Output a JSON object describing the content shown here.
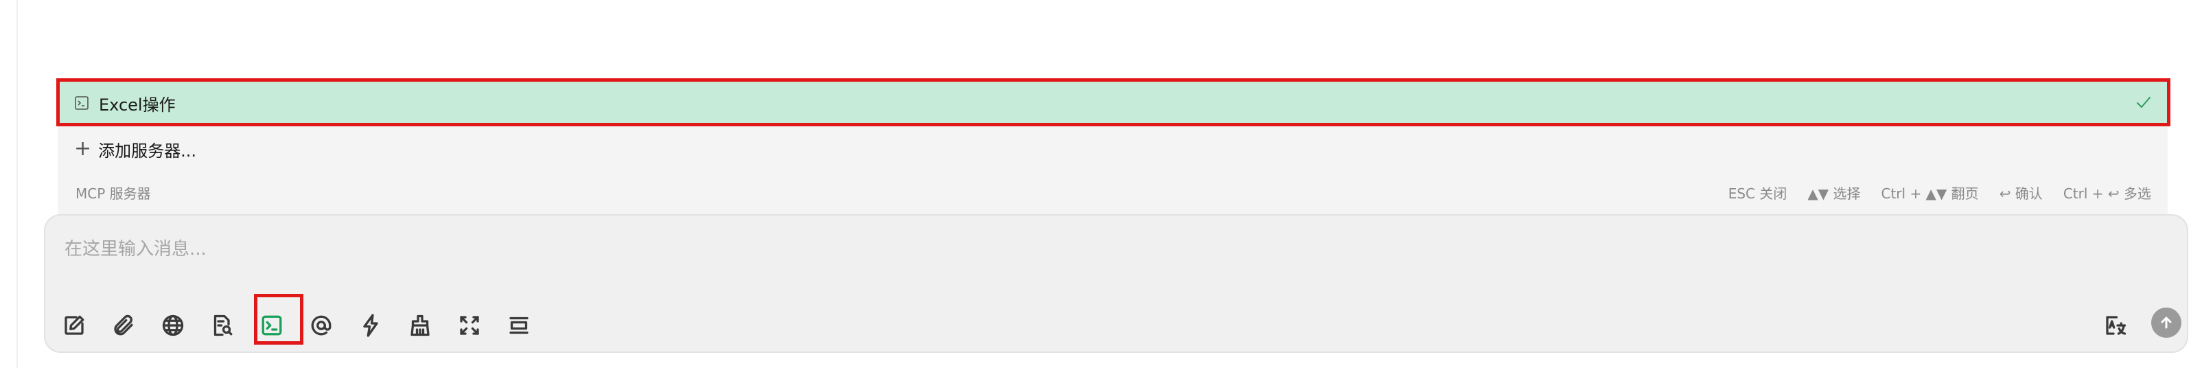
{
  "mcp_panel": {
    "servers": [
      {
        "label": "Excel操作",
        "selected": true,
        "icon": "terminal-icon"
      }
    ],
    "add_server_label": "添加服务器...",
    "footer_title": "MCP 服务器",
    "hints": [
      "ESC 关闭",
      "▲▼ 选择",
      "Ctrl + ▲▼ 翻页",
      "↩ 确认",
      "Ctrl + ↩ 多选"
    ]
  },
  "composer": {
    "placeholder": "在这里输入消息...",
    "tools": [
      "edit-icon",
      "attachment-icon",
      "globe-icon",
      "document-search-icon",
      "mcp-terminal-icon",
      "mention-icon",
      "lightning-icon",
      "clear-icon",
      "expand-icon",
      "newline-icon"
    ]
  },
  "colors": {
    "selected_row_bg": "#c6ebd8",
    "highlight_border": "#e01818",
    "terminal_green": "#19a05a"
  }
}
